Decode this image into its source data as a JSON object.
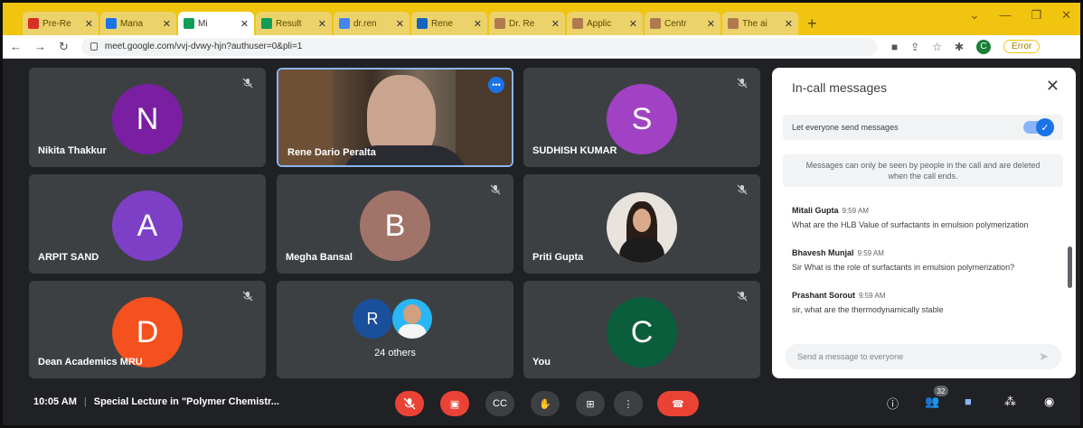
{
  "browser": {
    "tabs": [
      {
        "label": "Pre-Re",
        "color": "#d93025"
      },
      {
        "label": "Mana",
        "color": "#1a73e8"
      },
      {
        "label": "Mi",
        "color": "#0f9d58",
        "active": true
      },
      {
        "label": "Result",
        "color": "#0f9d58"
      },
      {
        "label": "dr.ren",
        "color": "#4285f4"
      },
      {
        "label": "Rene",
        "color": "#1565c0"
      },
      {
        "label": "Dr. Re",
        "color": "#b07a4f"
      },
      {
        "label": "Applic",
        "color": "#b07a4f"
      },
      {
        "label": "Centr",
        "color": "#b07a4f"
      },
      {
        "label": "The ai",
        "color": "#b07a4f"
      }
    ],
    "new_tab": "+",
    "url": "meet.google.com/vvj-dvwy-hjn?authuser=0&pli=1",
    "profile_initial": "C",
    "error_label": "Error"
  },
  "tiles": [
    {
      "name": "Nikita Thakkur",
      "initial": "N",
      "color": "#7b1fa2"
    },
    {
      "name": "Rene Dario Peralta"
    },
    {
      "name": "SUDHISH KUMAR",
      "initial": "S",
      "color": "#a142c4"
    },
    {
      "name": "ARPIT SAND",
      "initial": "A",
      "color": "#7e3fc7"
    },
    {
      "name": "Megha Bansal",
      "initial": "B",
      "color": "#a1746a"
    },
    {
      "name": "Priti Gupta"
    },
    {
      "name": "Dean Academics MRU",
      "initial": "D",
      "color": "#f4511e"
    },
    {
      "name": "24 others",
      "initial": "R",
      "color": "#1a4f9c"
    },
    {
      "name": "You",
      "initial": "C",
      "color": "#0b5e3c"
    }
  ],
  "chat": {
    "title": "In-call messages",
    "toggle_label": "Let everyone send messages",
    "notice": "Messages can only be seen by people in the call and are deleted when the call ends.",
    "messages": [
      {
        "sender": "Mitali Gupta",
        "time": "9:59 AM",
        "text": "What are the HLB Value  of surfactants in emulsion polymerization"
      },
      {
        "sender": "Bhavesh Munjal",
        "time": "9:59 AM",
        "text": "Sir What is the role of surfactants in emulsion polymerization?"
      },
      {
        "sender": "Prashant Sorout",
        "time": "9:59 AM",
        "text": "sir, what are the thermodynamically stable"
      }
    ],
    "input_placeholder": "Send a message to everyone"
  },
  "bottom": {
    "time": "10:05 AM",
    "meeting_title": "Special Lecture in \"Polymer Chemistr...",
    "people_count": "32"
  },
  "colors": {
    "accent": "#1a73e8",
    "danger": "#ea4335",
    "tile_bg": "#3c4043",
    "page_bg": "#202124"
  }
}
